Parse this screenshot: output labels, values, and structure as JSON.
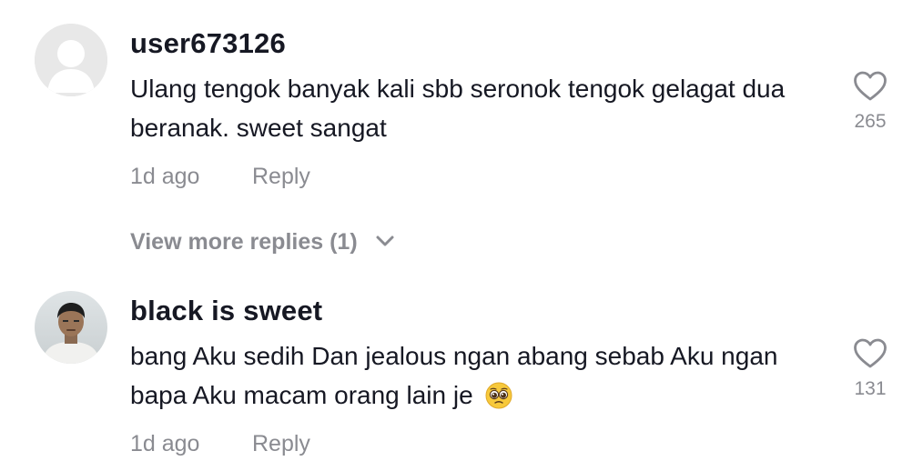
{
  "comments": [
    {
      "username": "user673126",
      "text": "Ulang tengok banyak kali sbb seronok tengok gelagat dua beranak. sweet sangat",
      "time": "1d ago",
      "reply_label": "Reply",
      "like_count": "265",
      "avatar_type": "default-avatar"
    },
    {
      "username": "black is sweet",
      "text": "bang Aku sedih Dan jealous ngan abang sebab Aku ngan bapa Aku macam orang lain je",
      "emoji": "🥺",
      "time": "1d ago",
      "reply_label": "Reply",
      "like_count": "131",
      "avatar_type": "photo-avatar"
    }
  ],
  "view_more": {
    "label": "View more replies (1)"
  },
  "colors": {
    "text_primary": "#161823",
    "text_secondary": "#8a8b91",
    "background": "#ffffff"
  },
  "icons": {
    "like": "heart-outline-icon",
    "expand": "chevron-down-icon"
  }
}
